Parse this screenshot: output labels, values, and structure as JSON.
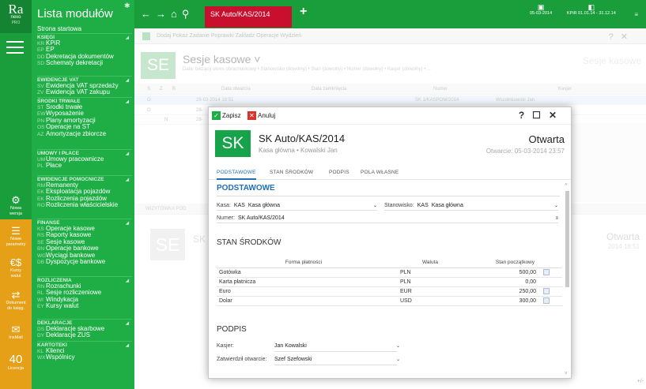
{
  "app": {
    "logo_big": "Ra",
    "logo_small": "nexo",
    "logo_edition": "PRO",
    "modules_title": "Lista modułów",
    "start_page": "Strona startowa"
  },
  "rail": {
    "items": [
      {
        "icon": "gear-globe-icon",
        "label1": "Nowa",
        "label2": "wersja"
      },
      {
        "icon": "document-list-icon",
        "label1": "Nowe",
        "label2": "parametry"
      },
      {
        "icon": "currency-exchange-icon",
        "label1": "Kursy",
        "label2": "walut"
      },
      {
        "icon": "document-transfer-icon",
        "label1": "Dokument",
        "label2": "do księg."
      },
      {
        "icon": "mail-icon",
        "label1": "InsMail",
        "label2": ""
      },
      {
        "icon": "license-count",
        "label1": "40",
        "label2": "Licencja"
      }
    ]
  },
  "menu": {
    "groups": [
      {
        "title": "KSIĘGI",
        "items": [
          {
            "ab": "KR",
            "label": "KPiR"
          },
          {
            "ab": "EP",
            "label": "EP"
          },
          {
            "ab": "DD",
            "label": "Dekretacja dokumentów"
          },
          {
            "ab": "SD",
            "label": "Schematy dekretacji"
          }
        ]
      },
      {
        "title": "EWIDENCJE VAT",
        "items": [
          {
            "ab": "SV",
            "label": "Ewidencja VAT sprzedaży"
          },
          {
            "ab": "ZV",
            "label": "Ewidencja VAT zakupu"
          }
        ]
      },
      {
        "title": "ŚRODKI TRWAŁE",
        "items": [
          {
            "ab": "ST",
            "label": "Środki trwałe"
          },
          {
            "ab": "EW",
            "label": "Wyposażenie"
          },
          {
            "ab": "PN",
            "label": "Plany amortyzacji"
          },
          {
            "ab": "OS",
            "label": "Operacje na ŚT"
          },
          {
            "ab": "AZ",
            "label": "Amortyzacje zbiorcze"
          }
        ]
      },
      {
        "title": "UMOWY I PŁACE",
        "items": [
          {
            "ab": "UM",
            "label": "Umowy pracownicze"
          },
          {
            "ab": "PL",
            "label": "Płace"
          }
        ]
      },
      {
        "title": "EWIDENCJE POMOCNICZE",
        "items": [
          {
            "ab": "RM",
            "label": "Remanenty"
          },
          {
            "ab": "EK",
            "label": "Eksploatacja pojazdów"
          },
          {
            "ab": "EK",
            "label": "Rozliczenia pojazdów"
          },
          {
            "ab": "RO",
            "label": "Rozliczenia właścicielskie"
          }
        ]
      },
      {
        "title": "FINANSE",
        "items": [
          {
            "ab": "KS",
            "label": "Operacje kasowe"
          },
          {
            "ab": "RS",
            "label": "Raporty kasowe"
          },
          {
            "ab": "SE",
            "label": "Sesje kasowe"
          },
          {
            "ab": "BN",
            "label": "Operacje bankowe"
          },
          {
            "ab": "WG",
            "label": "Wyciągi bankowe"
          },
          {
            "ab": "DB",
            "label": "Dyspozycje bankowe"
          }
        ]
      },
      {
        "title": "ROZLICZENIA",
        "items": [
          {
            "ab": "RN",
            "label": "Rozrachunki"
          },
          {
            "ab": "RL",
            "label": "Sesje rozliczeniowe"
          },
          {
            "ab": "WI",
            "label": "Windykacja"
          },
          {
            "ab": "EY",
            "label": "Kursy walut"
          }
        ]
      },
      {
        "title": "DEKLARACJE",
        "items": [
          {
            "ab": "DS",
            "label": "Deklaracje skarbowe"
          },
          {
            "ab": "DY",
            "label": "Deklaracje ZUS"
          }
        ]
      },
      {
        "title": "KARTOTEKI",
        "items": [
          {
            "ab": "KL",
            "label": "Klienci"
          },
          {
            "ab": "WX",
            "label": "Wspólnicy"
          }
        ]
      }
    ]
  },
  "topbar": {
    "active_tab": "SK Auto/KAS/2014",
    "add": "+",
    "date": "05-03-2014",
    "period": "KPiR 01.01.14 - 31.12.14",
    "more": "≡"
  },
  "background": {
    "toolbar": "Dodaj   Pokaż   Zadanie   Poprawki   Zakładz   Operacje   Wydzień",
    "se": "SE",
    "title": "Sesje kasowe ˅",
    "subtitle": "Data: bieżący okres obrachunkowy • Stanowisko (dowolny) • Stan (dowolny) • Numer (dowolny) • Kasjer (dowolny) • ...",
    "title_right": "Sesje kasowe",
    "columns": [
      "S",
      "Z",
      "B",
      "Data otwarcia",
      "Data zamknięcia",
      "Numer",
      "Kasjer"
    ],
    "rows": [
      {
        "s": "O",
        "date": "28-02-2014 18:51",
        "number": "SK 1/KASPOM/2014",
        "cashier": "Wszołnkowski Jan"
      },
      {
        "s": "O",
        "date": "28-",
        "number": "",
        "cashier": ""
      },
      {
        "s": "N",
        "date": "28-",
        "number": "",
        "cashier": ""
      }
    ],
    "subtab": "WIZYTÓWKA   POD",
    "sk": "SK",
    "se2": "SE",
    "status": "Otwarta",
    "status_date": "2014 18:51",
    "corner": "+/-"
  },
  "modal": {
    "save": "Zapisz",
    "cancel": "Anuluj",
    "ctrl_help": "?",
    "ctrl_max": "☐",
    "ctrl_close": "✕",
    "badge": "SK",
    "title": "SK Auto/KAS/2014",
    "subtitle": "Kasa główna • Kowalski Jan",
    "status": "Otwarta",
    "opened": "Otwarcie: 05-03-2014 23:57",
    "tabs": [
      "PODSTAWOWE",
      "STAN ŚRODKÓW",
      "PODPIS",
      "POLA WŁASNE"
    ],
    "basic": {
      "heading": "PODSTAWOWE",
      "kasa_label": "Kasa:",
      "kasa_code": "KAS",
      "kasa_name": "Kasa główna",
      "stanowisko_label": "Stanowisko:",
      "stanowisko_code": "KAS",
      "stanowisko_name": "Kasa główna",
      "numer_label": "Numer:",
      "numer_value": "SK Auto/KAS/2014"
    },
    "funds": {
      "heading": "STAN ŚRODKÓW",
      "col_form": "Forma płatności",
      "col_currency": "Waluta",
      "col_opening": "Stan początkowy",
      "rows": [
        {
          "form": "Gotówka",
          "currency": "PLN",
          "amount": "500,00",
          "cal": true
        },
        {
          "form": "Karta płatnicza",
          "currency": "PLN",
          "amount": "0,00",
          "cal": false
        },
        {
          "form": "Euro",
          "currency": "EUR",
          "amount": "250,00",
          "cal": true
        },
        {
          "form": "Dolar",
          "currency": "USD",
          "amount": "300,00",
          "cal": true
        }
      ]
    },
    "signature": {
      "heading": "PODPIS",
      "cashier_label": "Kasjer:",
      "cashier_value": "Jan Kowalski",
      "approve_label": "Zatwierdził otwarcie:",
      "approve_value": "Szef Szefowski"
    }
  },
  "colors": {
    "rail": "#1a9e3c",
    "module_panel": "#1fae46",
    "accent_orange": "#e5a017",
    "active_tab": "#c8102e",
    "link_blue": "#1f6fb5"
  }
}
